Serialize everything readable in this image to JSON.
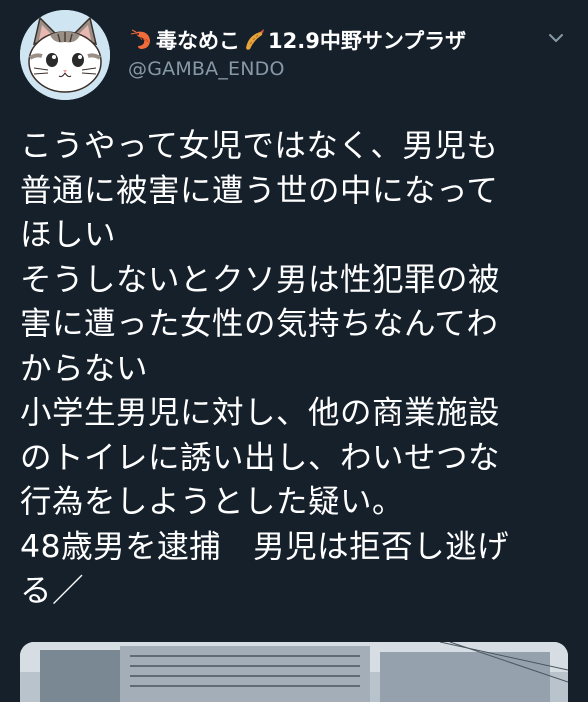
{
  "tweet": {
    "display_name_prefix": "毒なめこ",
    "display_name_suffix": "12.9中野サンプラザ",
    "prefix_emoji": "shrimp-icon",
    "middle_emoji": "fried-shrimp-icon",
    "handle": "@GAMBA_ENDO",
    "menu_icon": "chevron-down-icon",
    "lines": [
      "こうやって女児ではなく、男児も",
      "普通に被害に遭う世の中になって",
      "ほしい",
      "そうしないとクソ男は性犯罪の被",
      "害に遭った女性の気持ちなんてわ",
      "からない",
      "小学生男児に対し、他の商業施設",
      "のトイレに誘い出し、わいせつな",
      "行為をしようとした疑い。",
      "48歳男を逮捕　男児は拒否し逃げ",
      "る／"
    ]
  },
  "colors": {
    "background": "#15202b",
    "text": "#ffffff",
    "secondary": "#8899a6"
  }
}
